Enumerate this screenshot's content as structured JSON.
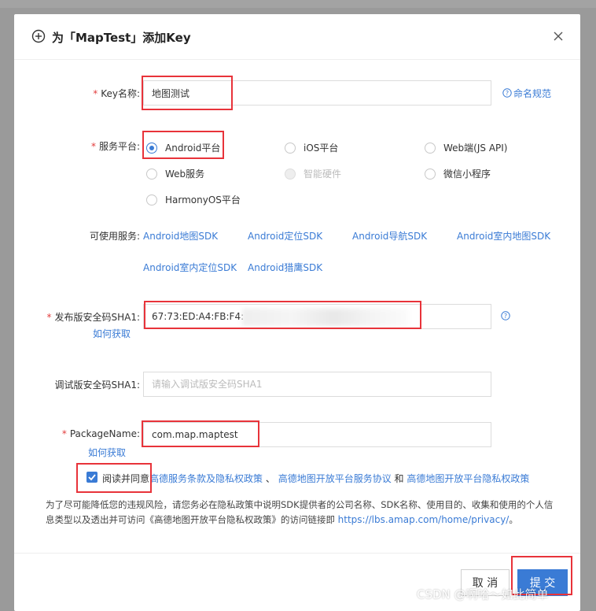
{
  "dialog": {
    "title": "为「MapTest」添加Key",
    "close_icon": "close-icon"
  },
  "key_name": {
    "label": "Key名称:",
    "value": "地图测试",
    "help_link": "命名规范"
  },
  "platform": {
    "label": "服务平台:",
    "options": [
      {
        "label": "Android平台",
        "checked": true,
        "disabled": false
      },
      {
        "label": "iOS平台",
        "checked": false,
        "disabled": false
      },
      {
        "label": "Web端(JS API)",
        "checked": false,
        "disabled": false
      },
      {
        "label": "Web服务",
        "checked": false,
        "disabled": false
      },
      {
        "label": "智能硬件",
        "checked": false,
        "disabled": true
      },
      {
        "label": "微信小程序",
        "checked": false,
        "disabled": false
      },
      {
        "label": "HarmonyOS平台",
        "checked": false,
        "disabled": false
      }
    ]
  },
  "services": {
    "label": "可使用服务:",
    "items": [
      "Android地图SDK",
      "Android定位SDK",
      "Android导航SDK",
      "Android室内地图SDK",
      "Android室内定位SDK",
      "Android猎鹰SDK"
    ]
  },
  "release_sha1": {
    "label": "发布版安全码SHA1:",
    "value": "67:73:ED:A4:FB:F4:",
    "how_link": "如何获取"
  },
  "debug_sha1": {
    "label": "调试版安全码SHA1:",
    "placeholder": "请输入调试版安全码SHA1"
  },
  "package_name": {
    "label": "PackageName:",
    "value": "com.map.maptest",
    "how_link": "如何获取"
  },
  "agreement": {
    "checked": true,
    "prefix": "阅读并同意",
    "link1": "高德服务条款及隐私权政策",
    "sep1": "、",
    "link2": "高德地图开放平台服务协议",
    "sep2": "和",
    "link3": "高德地图开放平台隐私权政策"
  },
  "notice": {
    "text": "为了尽可能降低您的违规风险，请您务必在隐私政策中说明SDK提供者的公司名称、SDK名称、使用目的、收集和使用的个人信息类型以及透出并可访问《高德地图开放平台隐私权政策》的访问链接即",
    "link": "https://lbs.amap.com/home/privacy/",
    "suffix": "。"
  },
  "footer": {
    "cancel_label": "取 消",
    "submit_label": "提 交"
  },
  "watermark": "CSDN @啊哈～如此简单",
  "colors": {
    "accent": "#3a7bd5",
    "required": "#e23c3c",
    "highlight_box": "#e8333a"
  }
}
